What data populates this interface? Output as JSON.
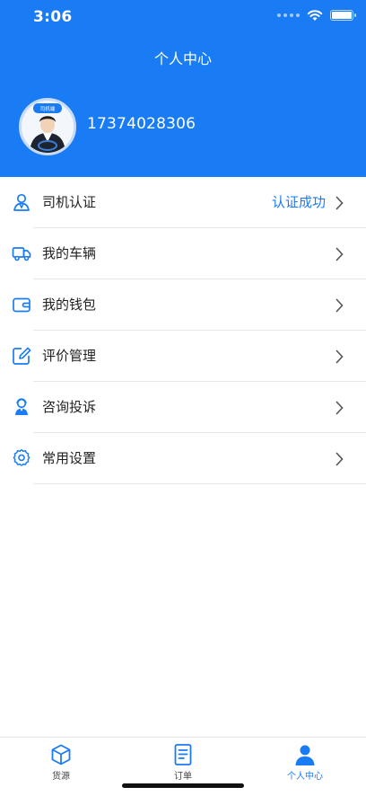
{
  "status_bar": {
    "time": "3:06"
  },
  "header": {
    "title": "个人中心",
    "avatar_badge": "司机端",
    "phone": "17374028306"
  },
  "menu": [
    {
      "icon": "driver-cert-icon",
      "label": "司机认证",
      "value": "认证成功"
    },
    {
      "icon": "truck-icon",
      "label": "我的车辆",
      "value": ""
    },
    {
      "icon": "wallet-icon",
      "label": "我的钱包",
      "value": ""
    },
    {
      "icon": "edit-icon",
      "label": "评价管理",
      "value": ""
    },
    {
      "icon": "service-agent-icon",
      "label": "咨询投诉",
      "value": ""
    },
    {
      "icon": "gear-icon",
      "label": "常用设置",
      "value": ""
    }
  ],
  "tabbar": [
    {
      "icon": "cube-icon",
      "label": "货源",
      "active": false
    },
    {
      "icon": "document-icon",
      "label": "订单",
      "active": false
    },
    {
      "icon": "person-icon",
      "label": "个人中心",
      "active": true
    }
  ],
  "colors": {
    "brand": "#1a7cf5"
  }
}
